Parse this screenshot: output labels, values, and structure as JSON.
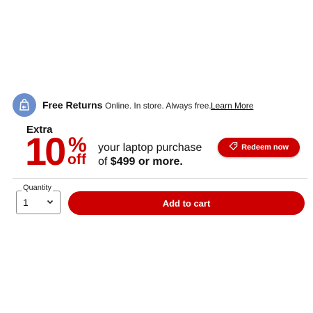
{
  "returns": {
    "title": "Free Returns",
    "description": "Online. In store. Always free.",
    "link": "Learn More",
    "icon": "return-bag-icon"
  },
  "promo": {
    "extra": "Extra",
    "number": "10",
    "percent": "%",
    "off": "off",
    "line1": "your laptop purchase",
    "line2_prefix": "of",
    "line2_bold": "$499 or more.",
    "redeem_label": "Redeem now",
    "redeem_icon": "tag-icon"
  },
  "quantity": {
    "label": "Quantity",
    "value": "1"
  },
  "cart": {
    "label": "Add to cart"
  },
  "colors": {
    "brand_red": "#cc0000",
    "returns_icon_bg": "#6b8fcc"
  }
}
